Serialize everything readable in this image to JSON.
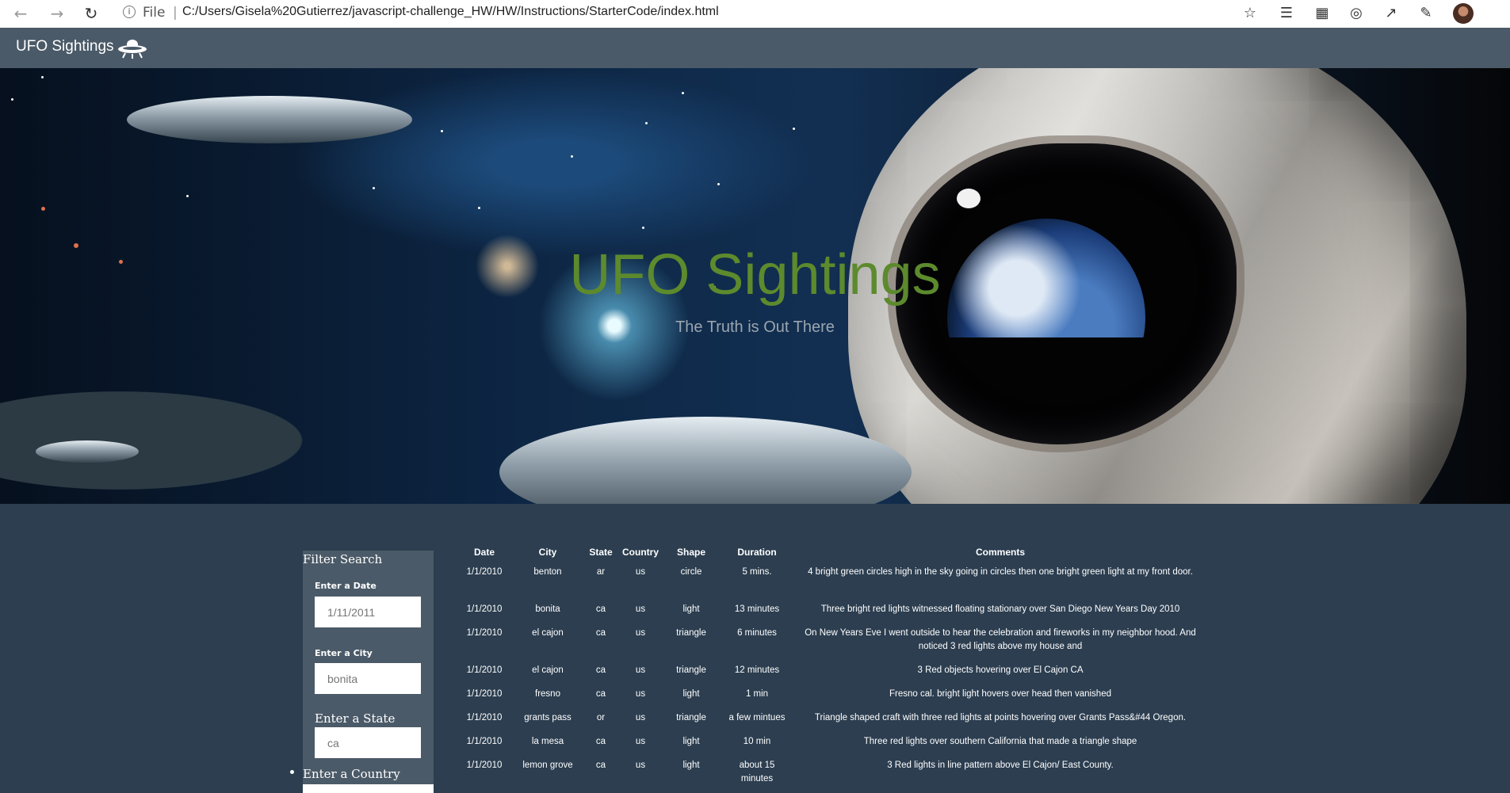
{
  "browser": {
    "address_prefix": "File",
    "url": "C:/Users/Gisela%20Gutierrez/javascript-challenge_HW/HW/Instructions/StarterCode/index.html"
  },
  "navbar": {
    "brand": "UFO Sightings",
    "brand_icon": "ufo-icon"
  },
  "hero": {
    "title": "UFO Sightings",
    "subtitle": "The Truth is Out There"
  },
  "filters": {
    "heading": "Filter Search",
    "date": {
      "label": "Enter a Date",
      "placeholder": "1/11/2011"
    },
    "city": {
      "label": "Enter a City",
      "placeholder": "bonita"
    },
    "state": {
      "label": "Enter a State",
      "placeholder": "ca"
    },
    "country": {
      "label": "Enter a Country"
    }
  },
  "table": {
    "headers": [
      "Date",
      "City",
      "State",
      "Country",
      "Shape",
      "Duration",
      "Comments"
    ],
    "rows": [
      [
        "1/1/2010",
        "benton",
        "ar",
        "us",
        "circle",
        "5 mins.",
        "4 bright green circles high in the sky going in circles then one bright green light at my front door."
      ],
      [
        "1/1/2010",
        "bonita",
        "ca",
        "us",
        "light",
        "13 minutes",
        "Three bright red lights witnessed floating stationary over San Diego New Years Day 2010"
      ],
      [
        "1/1/2010",
        "el cajon",
        "ca",
        "us",
        "triangle",
        "6 minutes",
        "On New Years Eve I went outside to hear the celebration and fireworks in my neighbor hood. And noticed 3 red lights above my house and"
      ],
      [
        "1/1/2010",
        "el cajon",
        "ca",
        "us",
        "triangle",
        "12 minutes",
        "3 Red objects hovering over El Cajon CA"
      ],
      [
        "1/1/2010",
        "fresno",
        "ca",
        "us",
        "light",
        "1 min",
        "Fresno cal. bright light hovers over head then vanished"
      ],
      [
        "1/1/2010",
        "grants pass",
        "or",
        "us",
        "triangle",
        "a few mintues",
        "Triangle shaped craft with three red lights at points hovering over Grants Pass&#44 Oregon."
      ],
      [
        "1/1/2010",
        "la mesa",
        "ca",
        "us",
        "light",
        "10 min",
        "Three red lights over southern California that made a triangle shape"
      ],
      [
        "1/1/2010",
        "lemon grove",
        "ca",
        "us",
        "light",
        "about 15 minutes",
        "3 Red lights in line pattern above El Cajon/ East County."
      ]
    ]
  }
}
